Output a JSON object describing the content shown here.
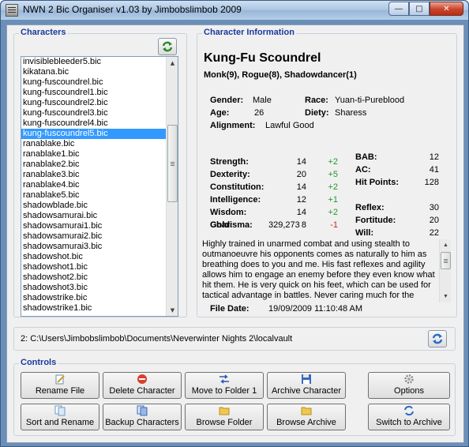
{
  "window": {
    "title": "NWN 2 Bic Organiser v1.03 by Jimbobslimbob 2009"
  },
  "characters_panel": {
    "label": "Characters",
    "items": [
      "invisiblebleeder5.bic",
      "kikatana.bic",
      "kung-fuscoundrel.bic",
      "kung-fuscoundrel1.bic",
      "kung-fuscoundrel2.bic",
      "kung-fuscoundrel3.bic",
      "kung-fuscoundrel4.bic",
      "kung-fuscoundrel5.bic",
      "ranablake.bic",
      "ranablake1.bic",
      "ranablake2.bic",
      "ranablake3.bic",
      "ranablake4.bic",
      "ranablake5.bic",
      "shadowblade.bic",
      "shadowsamurai.bic",
      "shadowsamurai1.bic",
      "shadowsamurai2.bic",
      "shadowsamurai3.bic",
      "shadowshot.bic",
      "shadowshot1.bic",
      "shadowshot2.bic",
      "shadowshot3.bic",
      "shadowstrike.bic",
      "shadowstrike1.bic"
    ],
    "selected": "kung-fuscoundrel5.bic"
  },
  "info": {
    "label": "Character Information",
    "name": "Kung-Fu Scoundrel",
    "classes": "Monk(9), Rogue(8), Shadowdancer(1)",
    "gender_label": "Gender:",
    "gender": "Male",
    "race_label": "Race:",
    "race": "Yuan-ti-Pureblood",
    "age_label": "Age:",
    "age": "26",
    "deity_label": "Diety:",
    "deity": "Sharess",
    "alignment_label": "Alignment:",
    "alignment": "Lawful Good",
    "abilities": [
      {
        "label": "Strength:",
        "value": "14",
        "mod": "+2",
        "neg": false
      },
      {
        "label": "Dexterity:",
        "value": "20",
        "mod": "+5",
        "neg": false
      },
      {
        "label": "Constitution:",
        "value": "14",
        "mod": "+2",
        "neg": false
      },
      {
        "label": "Intelligence:",
        "value": "12",
        "mod": "+1",
        "neg": false
      },
      {
        "label": "Wisdom:",
        "value": "14",
        "mod": "+2",
        "neg": false
      },
      {
        "label": "Charisma:",
        "value": "8",
        "mod": "-1",
        "neg": true
      }
    ],
    "combat": [
      {
        "label": "BAB:",
        "value": "12"
      },
      {
        "label": "AC:",
        "value": "41"
      },
      {
        "label": "Hit Points:",
        "value": "128"
      }
    ],
    "saves": [
      {
        "label": "Reflex:",
        "value": "30"
      },
      {
        "label": "Fortitude:",
        "value": "20"
      },
      {
        "label": "Will:",
        "value": "22"
      }
    ],
    "gold_label": "Gold:",
    "gold": "329,273",
    "description_lines": [
      "Highly trained in unarmed combat and using stealth to",
      "outmanoeuvre his opponents comes as naturally to him as",
      "breathing does to you and me. His fast reflexes and agility",
      "allows him to engage an enemy before they even know what",
      "hit them. He is very quick on his feet, which can be used for",
      "tactical advantage in battles. Never caring much for the"
    ],
    "file_date_label": "File Date:",
    "file_date": "19/09/2009 11:10:48 AM"
  },
  "path": {
    "value": "2: C:\\Users\\Jimbobslimbob\\Documents\\Neverwinter Nights 2\\localvault"
  },
  "controls": {
    "label": "Controls",
    "rename_file": "Rename File",
    "delete_character": "Delete Character",
    "move_to_folder": "Move to Folder 1",
    "archive_character": "Archive Character",
    "options": "Options",
    "sort_and_rename": "Sort and Rename",
    "backup_characters": "Backup Characters",
    "browse_folder": "Browse Folder",
    "browse_archive": "Browse Archive",
    "switch_to_archive": "Switch to Archive"
  }
}
